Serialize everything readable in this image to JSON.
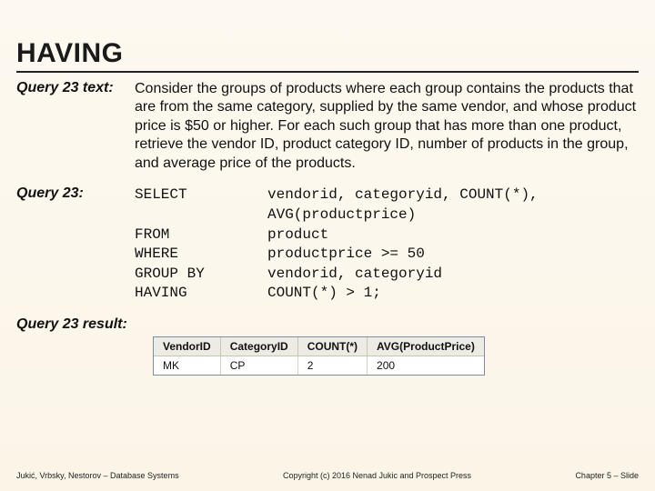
{
  "title": "HAVING",
  "queryTextLabel": "Query 23 text:",
  "queryText": "Consider the groups of products where each group contains the products that are from the same category, supplied by the same vendor, and whose product price is $50 or higher. For each such group that has more than one product, retrieve the vendor ID, product category ID, number of products in the group, and average price of the products.",
  "queryLabel": "Query 23:",
  "sql": {
    "select_kw": "SELECT",
    "select_val": "vendorid, categoryid, COUNT(*), AVG(productprice)",
    "from_kw": "FROM",
    "from_val": "product",
    "where_kw": "WHERE",
    "where_val": "productprice >= 50",
    "group_kw": "GROUP BY",
    "group_val": "vendorid, categoryid",
    "having_kw": "HAVING",
    "having_val": "COUNT(*) > 1;"
  },
  "resultLabel": "Query 23 result:",
  "resultTable": {
    "headers": [
      "VendorID",
      "CategoryID",
      "COUNT(*)",
      "AVG(ProductPrice)"
    ],
    "row": [
      "MK",
      "CP",
      "2",
      "200"
    ]
  },
  "footer": {
    "left": "Jukić, Vrbsky, Nestorov – Database Systems",
    "center": "Copyright (c) 2016 Nenad Jukic and Prospect Press",
    "right": "Chapter 5 – Slide"
  }
}
